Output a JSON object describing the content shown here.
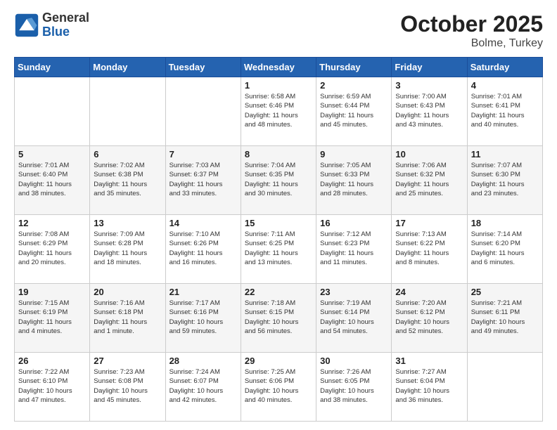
{
  "header": {
    "logo_general": "General",
    "logo_blue": "Blue",
    "title": "October 2025",
    "subtitle": "Bolme, Turkey"
  },
  "days_of_week": [
    "Sunday",
    "Monday",
    "Tuesday",
    "Wednesday",
    "Thursday",
    "Friday",
    "Saturday"
  ],
  "weeks": [
    [
      {
        "day": "",
        "info": ""
      },
      {
        "day": "",
        "info": ""
      },
      {
        "day": "",
        "info": ""
      },
      {
        "day": "1",
        "info": "Sunrise: 6:58 AM\nSunset: 6:46 PM\nDaylight: 11 hours\nand 48 minutes."
      },
      {
        "day": "2",
        "info": "Sunrise: 6:59 AM\nSunset: 6:44 PM\nDaylight: 11 hours\nand 45 minutes."
      },
      {
        "day": "3",
        "info": "Sunrise: 7:00 AM\nSunset: 6:43 PM\nDaylight: 11 hours\nand 43 minutes."
      },
      {
        "day": "4",
        "info": "Sunrise: 7:01 AM\nSunset: 6:41 PM\nDaylight: 11 hours\nand 40 minutes."
      }
    ],
    [
      {
        "day": "5",
        "info": "Sunrise: 7:01 AM\nSunset: 6:40 PM\nDaylight: 11 hours\nand 38 minutes."
      },
      {
        "day": "6",
        "info": "Sunrise: 7:02 AM\nSunset: 6:38 PM\nDaylight: 11 hours\nand 35 minutes."
      },
      {
        "day": "7",
        "info": "Sunrise: 7:03 AM\nSunset: 6:37 PM\nDaylight: 11 hours\nand 33 minutes."
      },
      {
        "day": "8",
        "info": "Sunrise: 7:04 AM\nSunset: 6:35 PM\nDaylight: 11 hours\nand 30 minutes."
      },
      {
        "day": "9",
        "info": "Sunrise: 7:05 AM\nSunset: 6:33 PM\nDaylight: 11 hours\nand 28 minutes."
      },
      {
        "day": "10",
        "info": "Sunrise: 7:06 AM\nSunset: 6:32 PM\nDaylight: 11 hours\nand 25 minutes."
      },
      {
        "day": "11",
        "info": "Sunrise: 7:07 AM\nSunset: 6:30 PM\nDaylight: 11 hours\nand 23 minutes."
      }
    ],
    [
      {
        "day": "12",
        "info": "Sunrise: 7:08 AM\nSunset: 6:29 PM\nDaylight: 11 hours\nand 20 minutes."
      },
      {
        "day": "13",
        "info": "Sunrise: 7:09 AM\nSunset: 6:28 PM\nDaylight: 11 hours\nand 18 minutes."
      },
      {
        "day": "14",
        "info": "Sunrise: 7:10 AM\nSunset: 6:26 PM\nDaylight: 11 hours\nand 16 minutes."
      },
      {
        "day": "15",
        "info": "Sunrise: 7:11 AM\nSunset: 6:25 PM\nDaylight: 11 hours\nand 13 minutes."
      },
      {
        "day": "16",
        "info": "Sunrise: 7:12 AM\nSunset: 6:23 PM\nDaylight: 11 hours\nand 11 minutes."
      },
      {
        "day": "17",
        "info": "Sunrise: 7:13 AM\nSunset: 6:22 PM\nDaylight: 11 hours\nand 8 minutes."
      },
      {
        "day": "18",
        "info": "Sunrise: 7:14 AM\nSunset: 6:20 PM\nDaylight: 11 hours\nand 6 minutes."
      }
    ],
    [
      {
        "day": "19",
        "info": "Sunrise: 7:15 AM\nSunset: 6:19 PM\nDaylight: 11 hours\nand 4 minutes."
      },
      {
        "day": "20",
        "info": "Sunrise: 7:16 AM\nSunset: 6:18 PM\nDaylight: 11 hours\nand 1 minute."
      },
      {
        "day": "21",
        "info": "Sunrise: 7:17 AM\nSunset: 6:16 PM\nDaylight: 10 hours\nand 59 minutes."
      },
      {
        "day": "22",
        "info": "Sunrise: 7:18 AM\nSunset: 6:15 PM\nDaylight: 10 hours\nand 56 minutes."
      },
      {
        "day": "23",
        "info": "Sunrise: 7:19 AM\nSunset: 6:14 PM\nDaylight: 10 hours\nand 54 minutes."
      },
      {
        "day": "24",
        "info": "Sunrise: 7:20 AM\nSunset: 6:12 PM\nDaylight: 10 hours\nand 52 minutes."
      },
      {
        "day": "25",
        "info": "Sunrise: 7:21 AM\nSunset: 6:11 PM\nDaylight: 10 hours\nand 49 minutes."
      }
    ],
    [
      {
        "day": "26",
        "info": "Sunrise: 7:22 AM\nSunset: 6:10 PM\nDaylight: 10 hours\nand 47 minutes."
      },
      {
        "day": "27",
        "info": "Sunrise: 7:23 AM\nSunset: 6:08 PM\nDaylight: 10 hours\nand 45 minutes."
      },
      {
        "day": "28",
        "info": "Sunrise: 7:24 AM\nSunset: 6:07 PM\nDaylight: 10 hours\nand 42 minutes."
      },
      {
        "day": "29",
        "info": "Sunrise: 7:25 AM\nSunset: 6:06 PM\nDaylight: 10 hours\nand 40 minutes."
      },
      {
        "day": "30",
        "info": "Sunrise: 7:26 AM\nSunset: 6:05 PM\nDaylight: 10 hours\nand 38 minutes."
      },
      {
        "day": "31",
        "info": "Sunrise: 7:27 AM\nSunset: 6:04 PM\nDaylight: 10 hours\nand 36 minutes."
      },
      {
        "day": "",
        "info": ""
      }
    ]
  ]
}
